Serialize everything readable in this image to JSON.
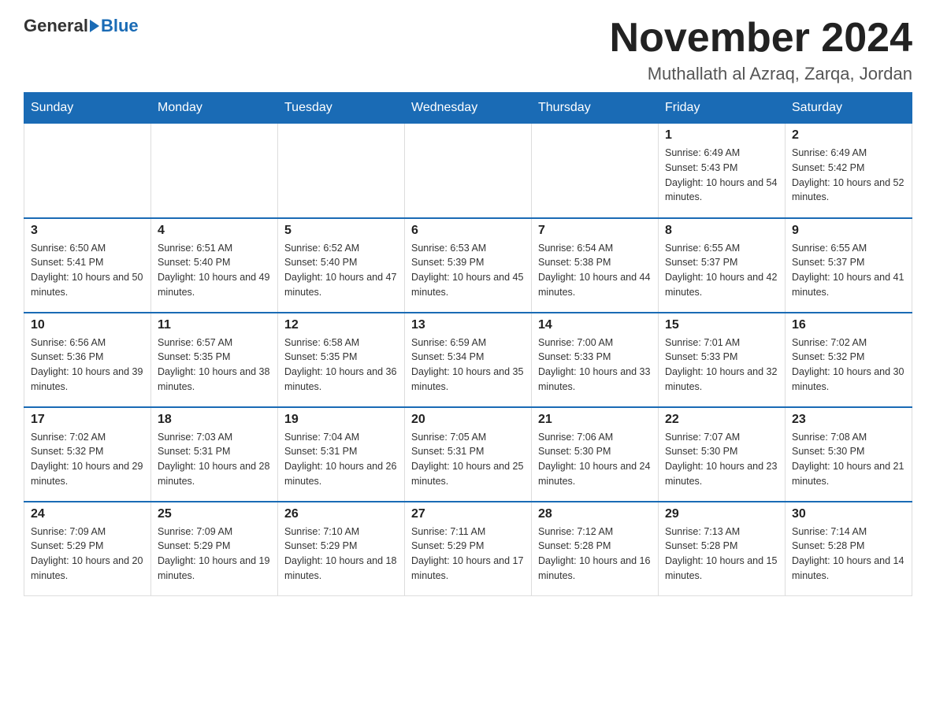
{
  "header": {
    "logo_general": "General",
    "logo_blue": "Blue",
    "calendar_title": "November 2024",
    "calendar_subtitle": "Muthallath al Azraq, Zarqa, Jordan"
  },
  "weekdays": [
    "Sunday",
    "Monday",
    "Tuesday",
    "Wednesday",
    "Thursday",
    "Friday",
    "Saturday"
  ],
  "weeks": [
    [
      {
        "day": "",
        "sunrise": "",
        "sunset": "",
        "daylight": ""
      },
      {
        "day": "",
        "sunrise": "",
        "sunset": "",
        "daylight": ""
      },
      {
        "day": "",
        "sunrise": "",
        "sunset": "",
        "daylight": ""
      },
      {
        "day": "",
        "sunrise": "",
        "sunset": "",
        "daylight": ""
      },
      {
        "day": "",
        "sunrise": "",
        "sunset": "",
        "daylight": ""
      },
      {
        "day": "1",
        "sunrise": "Sunrise: 6:49 AM",
        "sunset": "Sunset: 5:43 PM",
        "daylight": "Daylight: 10 hours and 54 minutes."
      },
      {
        "day": "2",
        "sunrise": "Sunrise: 6:49 AM",
        "sunset": "Sunset: 5:42 PM",
        "daylight": "Daylight: 10 hours and 52 minutes."
      }
    ],
    [
      {
        "day": "3",
        "sunrise": "Sunrise: 6:50 AM",
        "sunset": "Sunset: 5:41 PM",
        "daylight": "Daylight: 10 hours and 50 minutes."
      },
      {
        "day": "4",
        "sunrise": "Sunrise: 6:51 AM",
        "sunset": "Sunset: 5:40 PM",
        "daylight": "Daylight: 10 hours and 49 minutes."
      },
      {
        "day": "5",
        "sunrise": "Sunrise: 6:52 AM",
        "sunset": "Sunset: 5:40 PM",
        "daylight": "Daylight: 10 hours and 47 minutes."
      },
      {
        "day": "6",
        "sunrise": "Sunrise: 6:53 AM",
        "sunset": "Sunset: 5:39 PM",
        "daylight": "Daylight: 10 hours and 45 minutes."
      },
      {
        "day": "7",
        "sunrise": "Sunrise: 6:54 AM",
        "sunset": "Sunset: 5:38 PM",
        "daylight": "Daylight: 10 hours and 44 minutes."
      },
      {
        "day": "8",
        "sunrise": "Sunrise: 6:55 AM",
        "sunset": "Sunset: 5:37 PM",
        "daylight": "Daylight: 10 hours and 42 minutes."
      },
      {
        "day": "9",
        "sunrise": "Sunrise: 6:55 AM",
        "sunset": "Sunset: 5:37 PM",
        "daylight": "Daylight: 10 hours and 41 minutes."
      }
    ],
    [
      {
        "day": "10",
        "sunrise": "Sunrise: 6:56 AM",
        "sunset": "Sunset: 5:36 PM",
        "daylight": "Daylight: 10 hours and 39 minutes."
      },
      {
        "day": "11",
        "sunrise": "Sunrise: 6:57 AM",
        "sunset": "Sunset: 5:35 PM",
        "daylight": "Daylight: 10 hours and 38 minutes."
      },
      {
        "day": "12",
        "sunrise": "Sunrise: 6:58 AM",
        "sunset": "Sunset: 5:35 PM",
        "daylight": "Daylight: 10 hours and 36 minutes."
      },
      {
        "day": "13",
        "sunrise": "Sunrise: 6:59 AM",
        "sunset": "Sunset: 5:34 PM",
        "daylight": "Daylight: 10 hours and 35 minutes."
      },
      {
        "day": "14",
        "sunrise": "Sunrise: 7:00 AM",
        "sunset": "Sunset: 5:33 PM",
        "daylight": "Daylight: 10 hours and 33 minutes."
      },
      {
        "day": "15",
        "sunrise": "Sunrise: 7:01 AM",
        "sunset": "Sunset: 5:33 PM",
        "daylight": "Daylight: 10 hours and 32 minutes."
      },
      {
        "day": "16",
        "sunrise": "Sunrise: 7:02 AM",
        "sunset": "Sunset: 5:32 PM",
        "daylight": "Daylight: 10 hours and 30 minutes."
      }
    ],
    [
      {
        "day": "17",
        "sunrise": "Sunrise: 7:02 AM",
        "sunset": "Sunset: 5:32 PM",
        "daylight": "Daylight: 10 hours and 29 minutes."
      },
      {
        "day": "18",
        "sunrise": "Sunrise: 7:03 AM",
        "sunset": "Sunset: 5:31 PM",
        "daylight": "Daylight: 10 hours and 28 minutes."
      },
      {
        "day": "19",
        "sunrise": "Sunrise: 7:04 AM",
        "sunset": "Sunset: 5:31 PM",
        "daylight": "Daylight: 10 hours and 26 minutes."
      },
      {
        "day": "20",
        "sunrise": "Sunrise: 7:05 AM",
        "sunset": "Sunset: 5:31 PM",
        "daylight": "Daylight: 10 hours and 25 minutes."
      },
      {
        "day": "21",
        "sunrise": "Sunrise: 7:06 AM",
        "sunset": "Sunset: 5:30 PM",
        "daylight": "Daylight: 10 hours and 24 minutes."
      },
      {
        "day": "22",
        "sunrise": "Sunrise: 7:07 AM",
        "sunset": "Sunset: 5:30 PM",
        "daylight": "Daylight: 10 hours and 23 minutes."
      },
      {
        "day": "23",
        "sunrise": "Sunrise: 7:08 AM",
        "sunset": "Sunset: 5:30 PM",
        "daylight": "Daylight: 10 hours and 21 minutes."
      }
    ],
    [
      {
        "day": "24",
        "sunrise": "Sunrise: 7:09 AM",
        "sunset": "Sunset: 5:29 PM",
        "daylight": "Daylight: 10 hours and 20 minutes."
      },
      {
        "day": "25",
        "sunrise": "Sunrise: 7:09 AM",
        "sunset": "Sunset: 5:29 PM",
        "daylight": "Daylight: 10 hours and 19 minutes."
      },
      {
        "day": "26",
        "sunrise": "Sunrise: 7:10 AM",
        "sunset": "Sunset: 5:29 PM",
        "daylight": "Daylight: 10 hours and 18 minutes."
      },
      {
        "day": "27",
        "sunrise": "Sunrise: 7:11 AM",
        "sunset": "Sunset: 5:29 PM",
        "daylight": "Daylight: 10 hours and 17 minutes."
      },
      {
        "day": "28",
        "sunrise": "Sunrise: 7:12 AM",
        "sunset": "Sunset: 5:28 PM",
        "daylight": "Daylight: 10 hours and 16 minutes."
      },
      {
        "day": "29",
        "sunrise": "Sunrise: 7:13 AM",
        "sunset": "Sunset: 5:28 PM",
        "daylight": "Daylight: 10 hours and 15 minutes."
      },
      {
        "day": "30",
        "sunrise": "Sunrise: 7:14 AM",
        "sunset": "Sunset: 5:28 PM",
        "daylight": "Daylight: 10 hours and 14 minutes."
      }
    ]
  ]
}
